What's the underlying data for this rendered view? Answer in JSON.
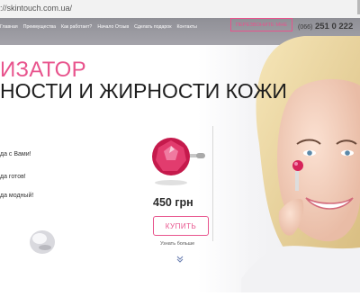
{
  "browser": {
    "url": "://skintouch.com.ua/"
  },
  "header": {
    "nav": [
      "Главная",
      "Преимущества",
      "Как работает?",
      "Начало Отзыв",
      "Сделать подарок",
      "Контакты"
    ],
    "callback_label": "ПЕРЕЗВОНИТЕ МНЕ",
    "phone_code": "(066)",
    "phone_number": "251 0 222"
  },
  "hero": {
    "title_line1": "ИЗАТОР",
    "title_line2": "НОСТИ И ЖИРНОСТИ КОЖИ",
    "benefits": [
      "да с Вами!",
      "да готов!",
      "да модный!"
    ]
  },
  "product": {
    "price": "450 грн",
    "buy_label": "КУПИТЬ",
    "more_label": "Узнать больше"
  },
  "colors": {
    "accent": "#e8548d",
    "header": "#9a99a0"
  },
  "icons": [
    "chevron-down-icon",
    "product-gem-image",
    "cream-drop-image",
    "woman-photo"
  ]
}
